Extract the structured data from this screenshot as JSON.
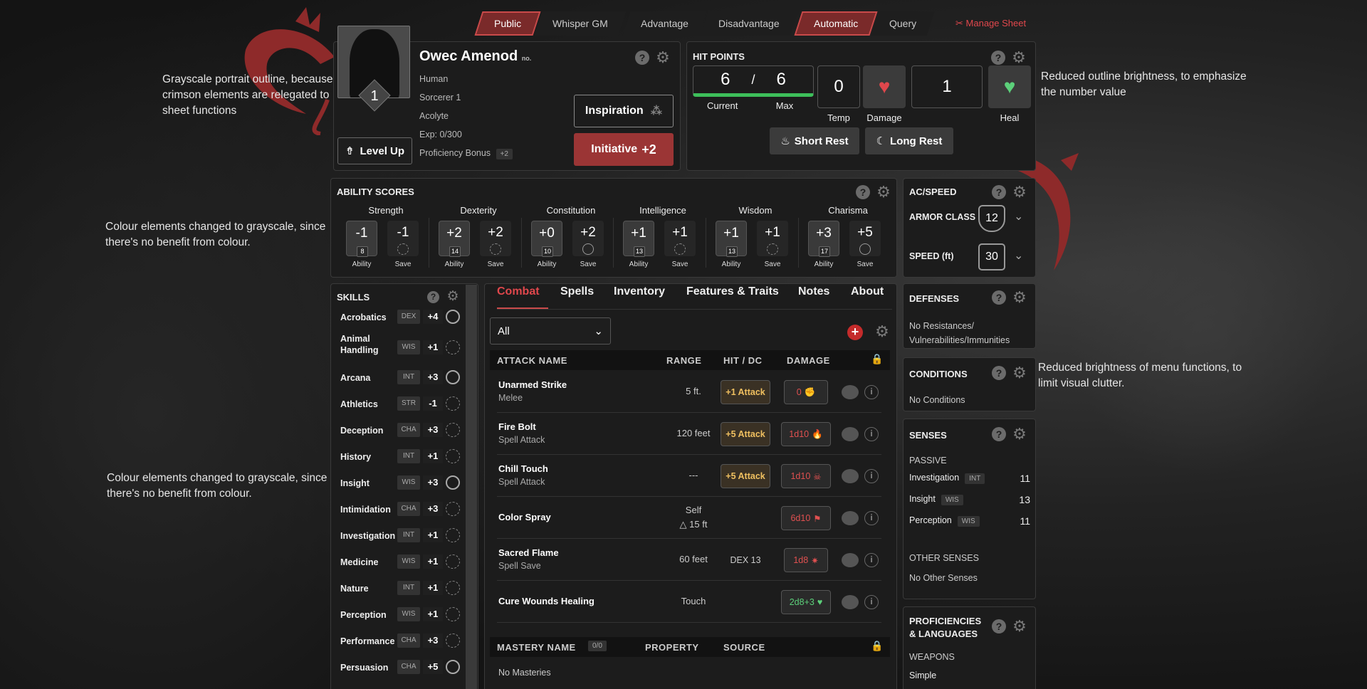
{
  "notes": {
    "portrait": "Grayscale portrait outline, because crimson elements are relegated to sheet functions",
    "abilities": "Colour elements changed to grayscale, since there's no benefit from colour.",
    "skills": "Colour elements changed to grayscale, since there's no benefit from colour.",
    "hp": "Reduced outline brightness, to emphasize the number value",
    "menus": "Reduced brightness of menu functions, to limit visual clutter."
  },
  "topbar": {
    "items": [
      "Public",
      "Whisper GM",
      "Advantage",
      "Disadvantage",
      "Automatic",
      "Query"
    ],
    "manage": "Manage Sheet"
  },
  "character": {
    "name": "Owec Amenod",
    "name_tag": "no.",
    "level": "1",
    "race": "Human",
    "class": "Sorcerer 1",
    "background": "Acolyte",
    "exp": "Exp: 0/300",
    "prof_label": "Proficiency Bonus",
    "prof_value": "+2",
    "level_up": "Level Up",
    "inspiration": "Inspiration",
    "initiative_label": "Initiative",
    "initiative_value": "+2"
  },
  "hp": {
    "title": "HIT POINTS",
    "current": "6",
    "slash": "/",
    "max": "6",
    "current_label": "Current",
    "max_label": "Max",
    "temp": "0",
    "temp_label": "Temp",
    "damage_label": "Damage",
    "amount": "1",
    "heal_label": "Heal",
    "short_rest": "Short Rest",
    "long_rest": "Long Rest"
  },
  "abilities": {
    "title": "ABILITY SCORES",
    "ability_label": "Ability",
    "save_label": "Save",
    "items": [
      {
        "name": "Strength",
        "mod": "-1",
        "score": "8",
        "save": "-1",
        "prof": false
      },
      {
        "name": "Dexterity",
        "mod": "+2",
        "score": "14",
        "save": "+2",
        "prof": false
      },
      {
        "name": "Constitution",
        "mod": "+0",
        "score": "10",
        "save": "+2",
        "prof": true
      },
      {
        "name": "Intelligence",
        "mod": "+1",
        "score": "13",
        "save": "+1",
        "prof": false
      },
      {
        "name": "Wisdom",
        "mod": "+1",
        "score": "13",
        "save": "+1",
        "prof": false
      },
      {
        "name": "Charisma",
        "mod": "+3",
        "score": "17",
        "save": "+5",
        "prof": true
      }
    ]
  },
  "acspeed": {
    "title": "AC/SPEED",
    "ac_label": "ARMOR CLASS",
    "ac": "12",
    "speed_label": "SPEED (ft)",
    "speed": "30"
  },
  "defenses": {
    "title": "DEFENSES",
    "text": "No Resistances/ Vulnerabilities/Immunities"
  },
  "conditions": {
    "title": "CONDITIONS",
    "text": "No Conditions"
  },
  "senses": {
    "title": "SENSES",
    "passive": "PASSIVE",
    "items": [
      {
        "name": "Investigation",
        "ab": "INT",
        "val": "11"
      },
      {
        "name": "Insight",
        "ab": "WIS",
        "val": "13"
      },
      {
        "name": "Perception",
        "ab": "WIS",
        "val": "11"
      }
    ],
    "other_title": "OTHER SENSES",
    "other": "No Other Senses"
  },
  "proficiencies": {
    "title": "PROFICIENCIES & LANGUAGES",
    "weapons": "WEAPONS",
    "weapons_val": "Simple"
  },
  "skills": {
    "title": "SKILLS",
    "items": [
      {
        "name": "Acrobatics",
        "ab": "DEX",
        "val": "+4",
        "prof": true
      },
      {
        "name": "Animal Handling",
        "ab": "WIS",
        "val": "+1",
        "prof": false
      },
      {
        "name": "Arcana",
        "ab": "INT",
        "val": "+3",
        "prof": true
      },
      {
        "name": "Athletics",
        "ab": "STR",
        "val": "-1",
        "prof": false
      },
      {
        "name": "Deception",
        "ab": "CHA",
        "val": "+3",
        "prof": false
      },
      {
        "name": "History",
        "ab": "INT",
        "val": "+1",
        "prof": false
      },
      {
        "name": "Insight",
        "ab": "WIS",
        "val": "+3",
        "prof": true
      },
      {
        "name": "Intimidation",
        "ab": "CHA",
        "val": "+3",
        "prof": false
      },
      {
        "name": "Investigation",
        "ab": "INT",
        "val": "+1",
        "prof": false
      },
      {
        "name": "Medicine",
        "ab": "WIS",
        "val": "+1",
        "prof": false
      },
      {
        "name": "Nature",
        "ab": "INT",
        "val": "+1",
        "prof": false
      },
      {
        "name": "Perception",
        "ab": "WIS",
        "val": "+1",
        "prof": false
      },
      {
        "name": "Performance",
        "ab": "CHA",
        "val": "+3",
        "prof": false
      },
      {
        "name": "Persuasion",
        "ab": "CHA",
        "val": "+5",
        "prof": true
      }
    ]
  },
  "tabs": [
    "Combat",
    "Spells",
    "Inventory",
    "Features & Traits",
    "Notes",
    "About"
  ],
  "filter": "All",
  "attacks": {
    "headers": [
      "ATTACK NAME",
      "RANGE",
      "HIT / DC",
      "DAMAGE"
    ],
    "rows": [
      {
        "name": "Unarmed Strike",
        "sub": "Melee",
        "range": "5 ft.",
        "range2": "",
        "hit": "+1 Attack",
        "hit_plain": false,
        "dmg": "0",
        "dmg_icon": "✊",
        "heal": false
      },
      {
        "name": "Fire Bolt",
        "sub": "Spell Attack",
        "range": "120 feet",
        "range2": "",
        "hit": "+5 Attack",
        "hit_plain": false,
        "dmg": "1d10",
        "dmg_icon": "🔥",
        "heal": false
      },
      {
        "name": "Chill Touch",
        "sub": "Spell Attack",
        "range": "---",
        "range2": "",
        "hit": "+5 Attack",
        "hit_plain": false,
        "dmg": "1d10",
        "dmg_icon": "☠",
        "heal": false
      },
      {
        "name": "Color Spray",
        "sub": "",
        "range": "Self",
        "range2": "△ 15 ft",
        "hit": "",
        "hit_plain": true,
        "dmg": "6d10",
        "dmg_icon": "⚑",
        "heal": false
      },
      {
        "name": "Sacred Flame",
        "sub": "Spell Save",
        "range": "60 feet",
        "range2": "",
        "hit": "DEX 13",
        "hit_plain": true,
        "dmg": "1d8",
        "dmg_icon": "✷",
        "heal": false
      },
      {
        "name": "Cure Wounds Healing",
        "sub": "",
        "range": "Touch",
        "range2": "",
        "hit": "",
        "hit_plain": true,
        "dmg": "2d8+3",
        "dmg_icon": "♥",
        "heal": true
      }
    ]
  },
  "mastery": {
    "headers": [
      "MASTERY NAME",
      "PROPERTY",
      "SOURCE"
    ],
    "count": "0/0",
    "empty": "No Masteries"
  },
  "colors": {
    "accent": "#9b3535",
    "hp_bar": "#3dbf5a",
    "heal": "#5cd07a",
    "damage": "#e05050"
  }
}
